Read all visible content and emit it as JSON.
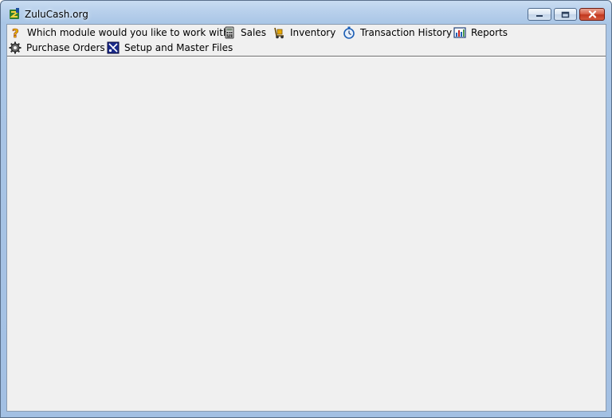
{
  "window": {
    "title": "ZuluCash.org",
    "controls": {
      "minimize_icon": "minimize-icon",
      "maximize_icon": "maximize-icon",
      "close_icon": "close-icon"
    }
  },
  "toolbar": {
    "prompt": {
      "label": "Which module would you like to work with?",
      "icon": "question-icon"
    },
    "items": [
      {
        "label": "Sales",
        "icon": "calculator-icon"
      },
      {
        "label": "Inventory",
        "icon": "hand-truck-icon"
      },
      {
        "label": "Transaction History",
        "icon": "stopwatch-icon"
      },
      {
        "label": "Reports",
        "icon": "bar-chart-icon"
      },
      {
        "label": "Purchase Orders",
        "icon": "gear-icon"
      },
      {
        "label": "Setup and Master Files",
        "icon": "setup-icon"
      }
    ]
  },
  "colors": {
    "frame": "#a3c0e3",
    "client": "#f0f0f0",
    "close_button": "#c1381f",
    "prompt_icon": "#e8c000"
  }
}
